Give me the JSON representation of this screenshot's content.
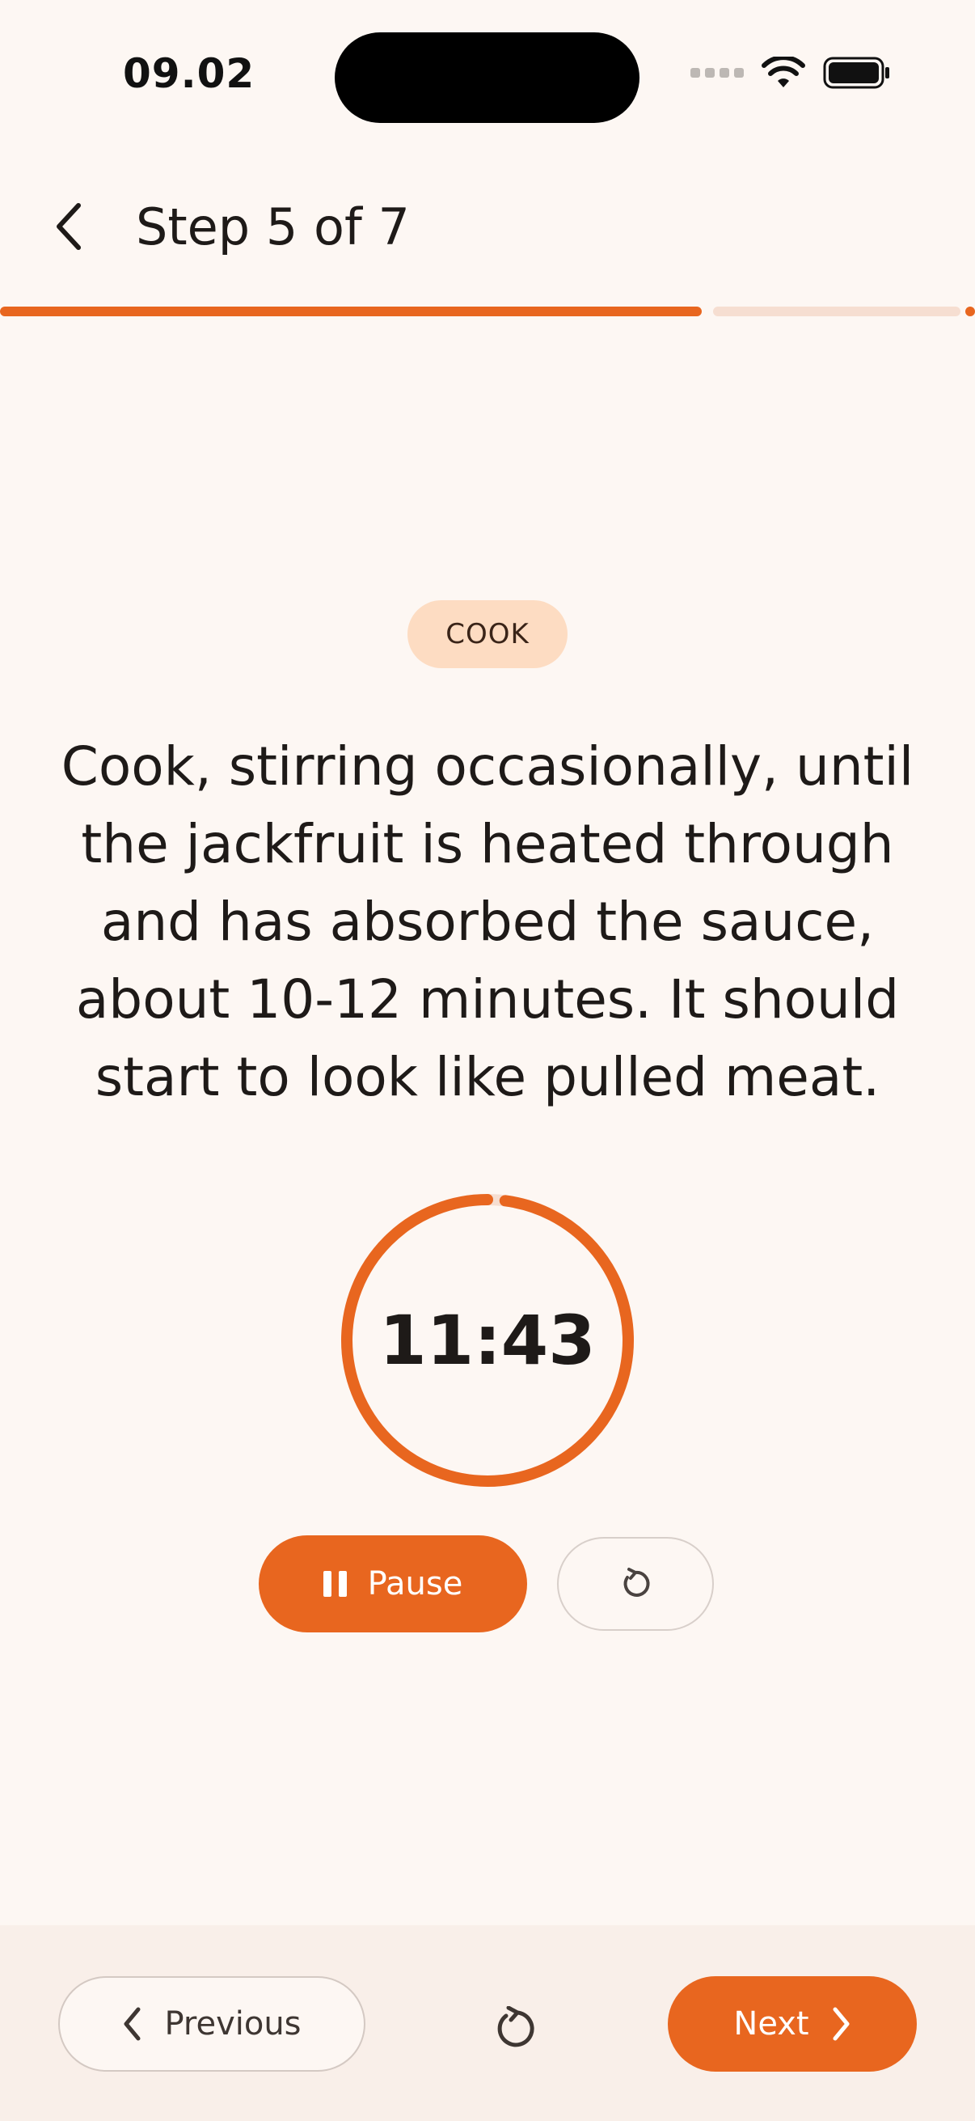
{
  "status_bar": {
    "time": "09.02"
  },
  "header": {
    "title": "Step 5 of 7",
    "back_icon": "chevron-left-icon"
  },
  "progress": {
    "current_step": 5,
    "total_steps": 7,
    "fraction": 0.72,
    "color_done": "#E8661F",
    "color_remaining": "#F6DED1"
  },
  "step": {
    "tag": "COOK",
    "instruction": "Cook, stirring occasionally, until the jackfruit is heated through and has absorbed the sauce, about 10-12 minutes. It should start to look like pulled meat."
  },
  "timer": {
    "display": "11:43",
    "remaining_fraction": 0.98,
    "ring_color": "#E8661F"
  },
  "timer_controls": {
    "pause_label": "Pause",
    "pause_icon": "pause-icon",
    "reset_icon": "reset-icon"
  },
  "navigation": {
    "previous_label": "Previous",
    "next_label": "Next",
    "restart_icon": "restart-icon"
  },
  "colors": {
    "accent": "#E8661F",
    "background": "#FDF7F3",
    "tag_background": "#FDDCC2"
  }
}
